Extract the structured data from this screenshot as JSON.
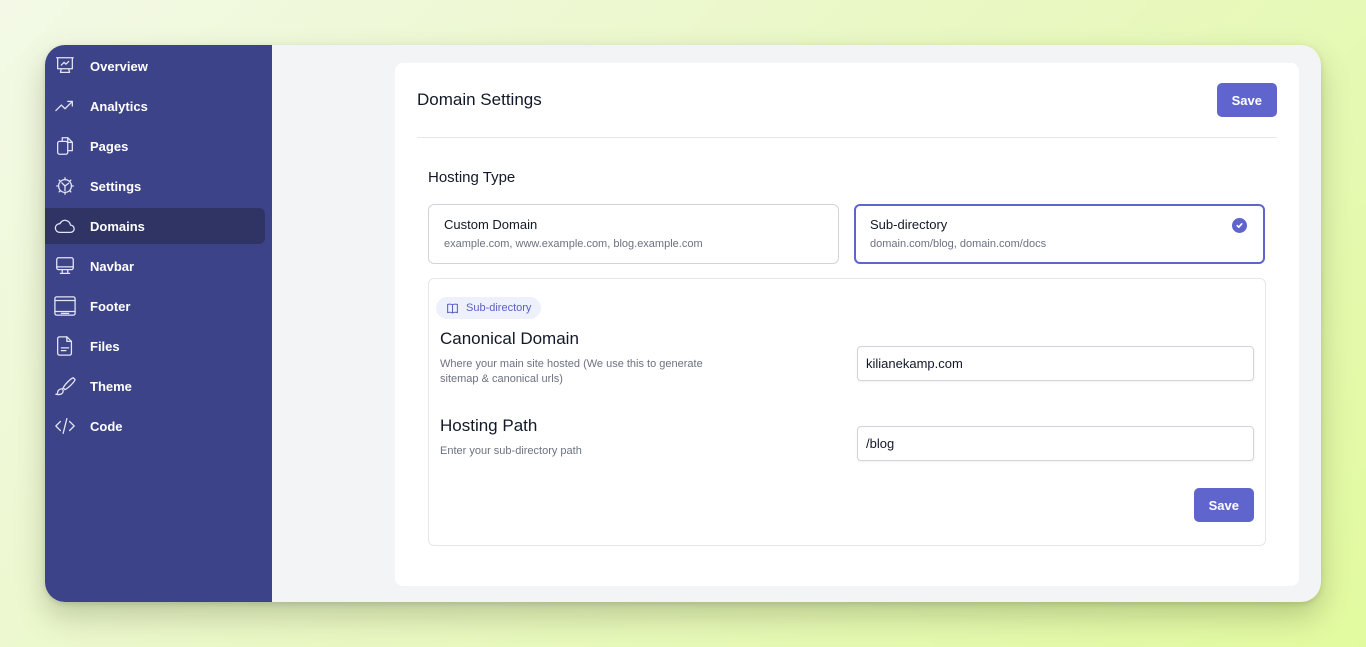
{
  "sidebar": {
    "items": [
      {
        "label": "Overview",
        "icon": "presentation-chart-icon",
        "active": false
      },
      {
        "label": "Analytics",
        "icon": "trending-up-icon",
        "active": false
      },
      {
        "label": "Pages",
        "icon": "documents-icon",
        "active": false
      },
      {
        "label": "Settings",
        "icon": "gear-icon",
        "active": false
      },
      {
        "label": "Domains",
        "icon": "cloud-icon",
        "active": true
      },
      {
        "label": "Navbar",
        "icon": "monitor-icon",
        "active": false
      },
      {
        "label": "Footer",
        "icon": "browser-window-icon",
        "active": false
      },
      {
        "label": "Files",
        "icon": "file-text-icon",
        "active": false
      },
      {
        "label": "Theme",
        "icon": "paintbrush-icon",
        "active": false
      },
      {
        "label": "Code",
        "icon": "code-icon",
        "active": false
      }
    ]
  },
  "header": {
    "title": "Domain Settings",
    "save_label": "Save"
  },
  "hosting_type": {
    "label": "Hosting Type",
    "options": [
      {
        "title": "Custom Domain",
        "description": "example.com, www.example.com, blog.example.com",
        "selected": false
      },
      {
        "title": "Sub-directory",
        "description": "domain.com/blog, domain.com/docs",
        "selected": true
      }
    ]
  },
  "panel": {
    "badge": "Sub-directory",
    "canonical": {
      "title": "Canonical Domain",
      "description": "Where your main site hosted (We use this to generate sitemap & canonical urls)",
      "value": "kilianekamp.com"
    },
    "hosting_path": {
      "title": "Hosting Path",
      "description": "Enter your sub-directory path",
      "value": "/blog"
    },
    "save_label": "Save"
  },
  "colors": {
    "sidebar_bg": "#3c4388",
    "sidebar_active": "#2f3465",
    "accent": "#5f65cc"
  }
}
